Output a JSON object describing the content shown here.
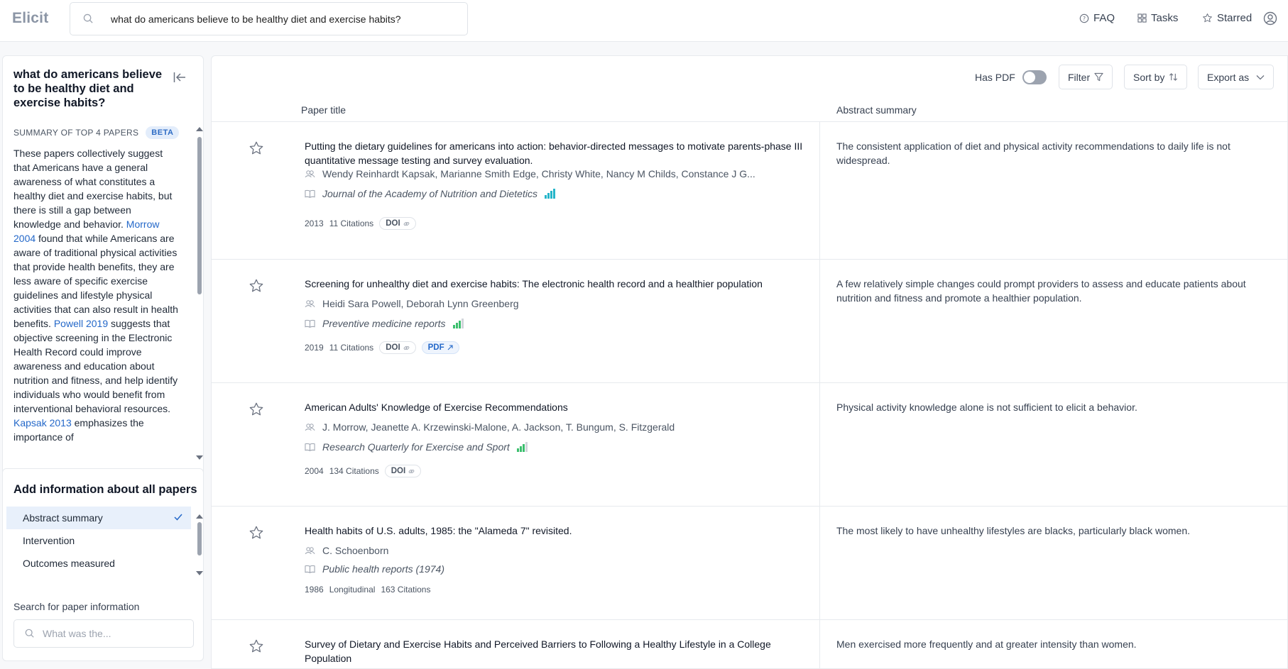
{
  "app": {
    "logo": "Elicit"
  },
  "search": {
    "query": "what do americans believe to be healthy diet and exercise habits?"
  },
  "nav": {
    "faq": "FAQ",
    "tasks": "Tasks",
    "starred": "Starred"
  },
  "left_panel": {
    "question": "what do americans believe to be healthy diet and exercise habits?",
    "summary_heading": "SUMMARY OF TOP 4 PAPERS",
    "beta_badge": "BETA",
    "summary": {
      "p1": "These papers collectively suggest that Americans have a general awareness of what constitutes a healthy diet and exercise habits, but there is still a gap between knowledge and behavior. ",
      "link1": "Morrow 2004",
      "p2": " found that while Americans are aware of traditional physical activities that provide health benefits, they are less aware of specific exercise guidelines and lifestyle physical activities that can also result in health benefits. ",
      "link2": "Powell 2019",
      "p3": " suggests that objective screening in the Electronic Health Record could improve awareness and education about nutrition and fitness, and help identify individuals who would benefit from interventional behavioral resources. ",
      "link3": "Kapsak 2013",
      "p4": " emphasizes the importance of"
    }
  },
  "add_info": {
    "title": "Add information about all papers",
    "columns": [
      "Abstract summary",
      "Intervention",
      "Outcomes measured"
    ],
    "search_label": "Search for paper information",
    "search_placeholder": "What was the..."
  },
  "toolbar": {
    "has_pdf": "Has PDF",
    "filter": "Filter",
    "sort_by": "Sort by",
    "export_as": "Export as"
  },
  "table": {
    "col_title": "Paper title",
    "col_abstract": "Abstract summary"
  },
  "colors": {
    "accent": "#2468c9",
    "bars_teal": "#26b5c9",
    "bars_green": "#3cbf6e"
  },
  "papers": [
    {
      "title": "Putting the dietary guidelines for americans into action: behavior-directed messages to motivate parents-phase III quantitative message testing and survey evaluation.",
      "authors": "Wendy Reinhardt Kapsak, Marianne Smith Edge, Christy White, Nancy M Childs, Constance J G...",
      "journal": "Journal of the Academy of Nutrition and Dietetics",
      "year": "2013",
      "citations": "11 Citations",
      "doi": "DOI",
      "abstract": "The consistent application of diet and physical activity recommendations to daily life is not widespread."
    },
    {
      "title": "Screening for unhealthy diet and exercise habits: The electronic health record and a healthier population",
      "authors": "Heidi Sara Powell, Deborah Lynn Greenberg",
      "journal": "Preventive medicine reports",
      "year": "2019",
      "citations": "11 Citations",
      "doi": "DOI",
      "pdf": "PDF",
      "abstract": "A few relatively simple changes could prompt providers to assess and educate patients about nutrition and fitness and promote a healthier population."
    },
    {
      "title": "American Adults' Knowledge of Exercise Recommendations",
      "authors": "J. Morrow, Jeanette A. Krzewinski-Malone, A. Jackson, T. Bungum, S. Fitzgerald",
      "journal": "Research Quarterly for Exercise and Sport",
      "year": "2004",
      "citations": "134 Citations",
      "doi": "DOI",
      "abstract": "Physical activity knowledge alone is not sufficient to elicit a behavior."
    },
    {
      "title": "Health habits of U.S. adults, 1985: the \"Alameda 7\" revisited.",
      "authors": "C. Schoenborn",
      "journal": "Public health reports (1974)",
      "year": "1986",
      "study_type": "Longitudinal",
      "citations": "163 Citations",
      "abstract": "The most likely to have unhealthy lifestyles are blacks, particularly black women."
    },
    {
      "title": "Survey of Dietary and Exercise Habits and Perceived Barriers to Following a Healthy Lifestyle in a College Population",
      "abstract": "Men exercised more frequently and at greater intensity than women."
    }
  ]
}
